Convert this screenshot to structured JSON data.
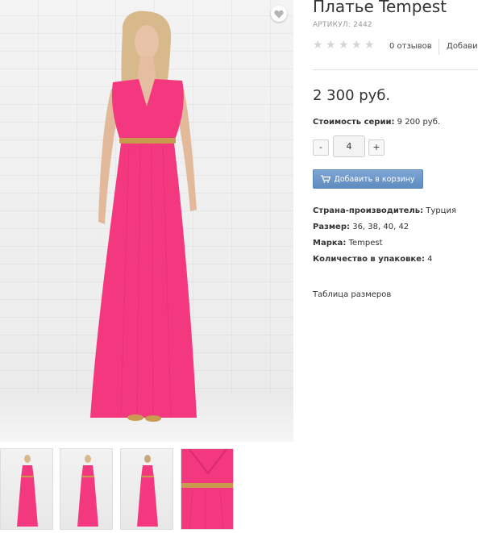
{
  "product": {
    "title": "Платье Tempest",
    "sku": "АРТИКУЛ: 2442",
    "rating_stars": 0,
    "reviews": "0 отзывов",
    "add_link": "Добави",
    "price": "2 300 руб.",
    "series_label": "Стоимость серии:",
    "series_value": "9 200 руб."
  },
  "quantity": {
    "minus": "-",
    "value": "4",
    "plus": "+"
  },
  "cart_button": {
    "label": "Добавить в корзину",
    "icon": "cart-icon"
  },
  "attributes": [
    {
      "label": "Страна-производитель:",
      "value": "Турция"
    },
    {
      "label": "Размер:",
      "value": "36, 38, 40, 42"
    },
    {
      "label": "Марка:",
      "value": "Tempest"
    },
    {
      "label": "Количество в упаковке:",
      "value": "4"
    }
  ],
  "size_table_link": "Таблица размеров",
  "colors": {
    "dress": "#f4387f",
    "button": "#6b96c9",
    "star": "#d4d4d4"
  }
}
